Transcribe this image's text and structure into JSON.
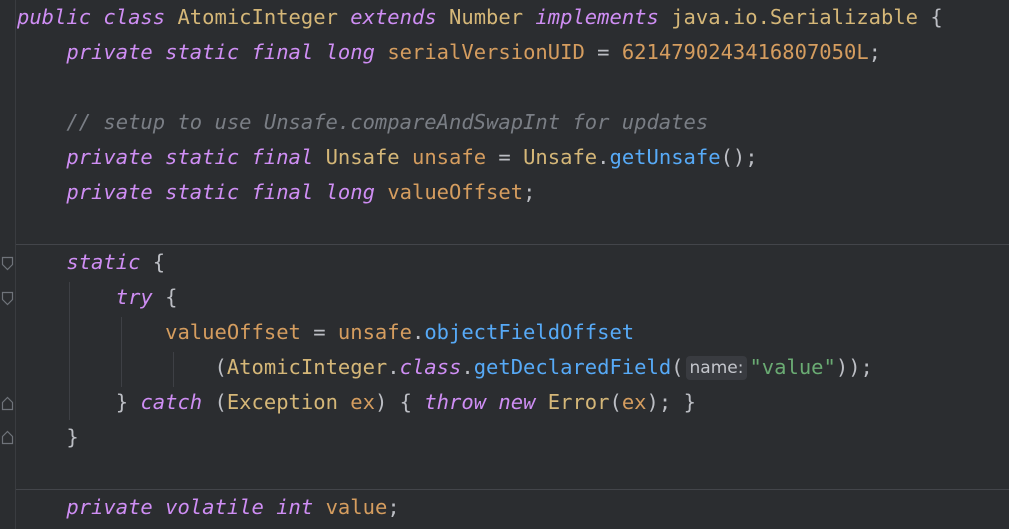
{
  "code": {
    "l1": {
      "t1": "public",
      "t2": "class",
      "t3": "AtomicInteger",
      "t4": "extends",
      "t5": "Number",
      "t6": "implements",
      "t7": "java.io.Serializable",
      "t8": "{"
    },
    "l2": {
      "t1": "private",
      "t2": "static",
      "t3": "final",
      "t4": "long",
      "t5": "serialVersionUID",
      "t6": "=",
      "t7": "6214790243416807050L",
      "t8": ";"
    },
    "l4": {
      "comment": "// setup to use Unsafe.compareAndSwapInt for updates"
    },
    "l5": {
      "t1": "private",
      "t2": "static",
      "t3": "final",
      "t4": "Unsafe",
      "t5": "unsafe",
      "t6": "=",
      "t7": "Unsafe",
      "t8": ".",
      "t9": "getUnsafe",
      "t10": "();"
    },
    "l6": {
      "t1": "private",
      "t2": "static",
      "t3": "final",
      "t4": "long",
      "t5": "valueOffset",
      "t6": ";"
    },
    "l8": {
      "t1": "static",
      "t2": "{"
    },
    "l9": {
      "t1": "try",
      "t2": "{"
    },
    "l10": {
      "t1": "valueOffset",
      "t2": "=",
      "t3": "unsafe",
      "t4": ".",
      "t5": "objectFieldOffset"
    },
    "l11": {
      "t1": "(",
      "t2": "AtomicInteger",
      "t3": ".",
      "t4": "class",
      "t5": ".",
      "t6": "getDeclaredField",
      "t7": "(",
      "hint": "name:",
      "t8": "\"value\"",
      "t9": "));"
    },
    "l12": {
      "t1": "}",
      "t2": "catch",
      "t3": "(",
      "t4": "Exception",
      "t5": "ex",
      "t6": ")",
      "t7": "{",
      "t8": "throw",
      "t9": "new",
      "t10": "Error",
      "t11": "(",
      "t12": "ex",
      "t13": ");",
      "t14": "}"
    },
    "l13": {
      "t1": "}"
    },
    "l15": {
      "t1": "private",
      "t2": "volatile",
      "t3": "int",
      "t4": "value",
      "t5": ";"
    }
  },
  "gutter": {
    "fold_icons": [
      "fold-start-icon",
      "fold-start-icon",
      "fold-end-icon",
      "fold-end-icon"
    ]
  },
  "colors": {
    "background": "#2b2d30",
    "keyword": "#cf8ef4",
    "type": "#d5b778",
    "field": "#d59d5f",
    "method": "#57aaf7",
    "comment": "#7a7e85",
    "string": "#6aab73",
    "plain": "#bcbec4"
  }
}
